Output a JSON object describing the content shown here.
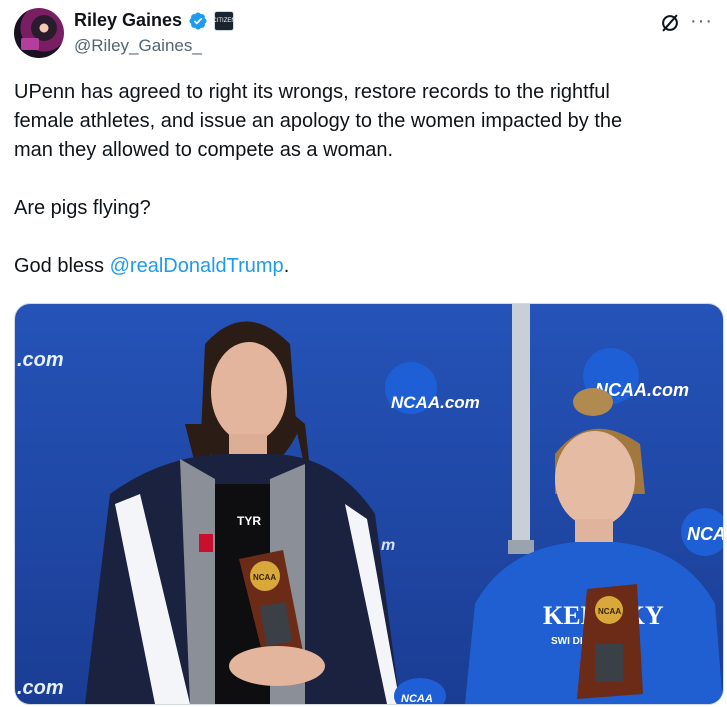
{
  "author": {
    "display_name": "Riley Gaines",
    "handle": "@Riley_Gaines_",
    "affiliate_badge": "CITIZEN"
  },
  "tweet": {
    "line1": "UPenn has agreed to right its wrongs, restore records to the rightful",
    "line2": "female athletes, and issue an apology to the women impacted by the",
    "line3": "man they allowed to compete as a woman.",
    "line4": "Are pigs flying?",
    "line5_prefix": "God bless ",
    "mention": "@realDonaldTrump",
    "line5_suffix": "."
  },
  "media": {
    "backdrop_texts": [
      ".com",
      "NCAA.com",
      "NCAA.com",
      "NCA",
      "m",
      ".com",
      "NCAA"
    ],
    "left_suit_logo": "TYR",
    "trophy_label_left": "NCAA",
    "trophy_label_right": "NCAA",
    "right_jersey_text": "KEN CKY",
    "right_jersey_sub": "SWI  DIVING"
  },
  "colors": {
    "accent": "#1d9bf0",
    "text": "#0f1419",
    "muted": "#536471",
    "backdrop_blue": "#1f46a8"
  }
}
